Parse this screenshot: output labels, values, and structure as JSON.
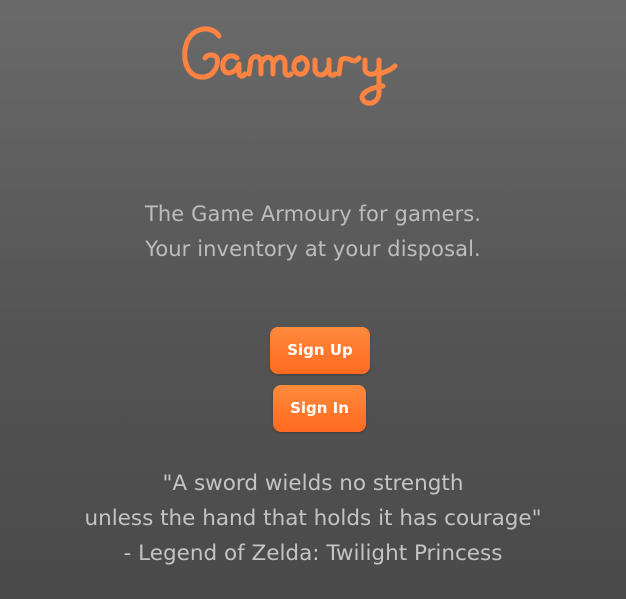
{
  "brand": {
    "logo_text": "Gamoury",
    "logo_color": "#ff8442",
    "logo_icon": "gamoury-script-wordmark"
  },
  "tagline": {
    "line1": "The Game Armoury for gamers.",
    "line2": "Your inventory at your disposal."
  },
  "actions": {
    "signup_label": "Sign Up",
    "signin_label": "Sign In",
    "accent_color": "#ff6f24"
  },
  "quote": {
    "line1": "\"A sword wields no strength",
    "line2": "unless the hand that holds it has courage\"",
    "line3": "- Legend of Zelda: Twilight Princess"
  },
  "colors": {
    "background_top": "#6a6a6a",
    "background_bottom": "#4a4a4a",
    "text": "#c0c0c0"
  }
}
